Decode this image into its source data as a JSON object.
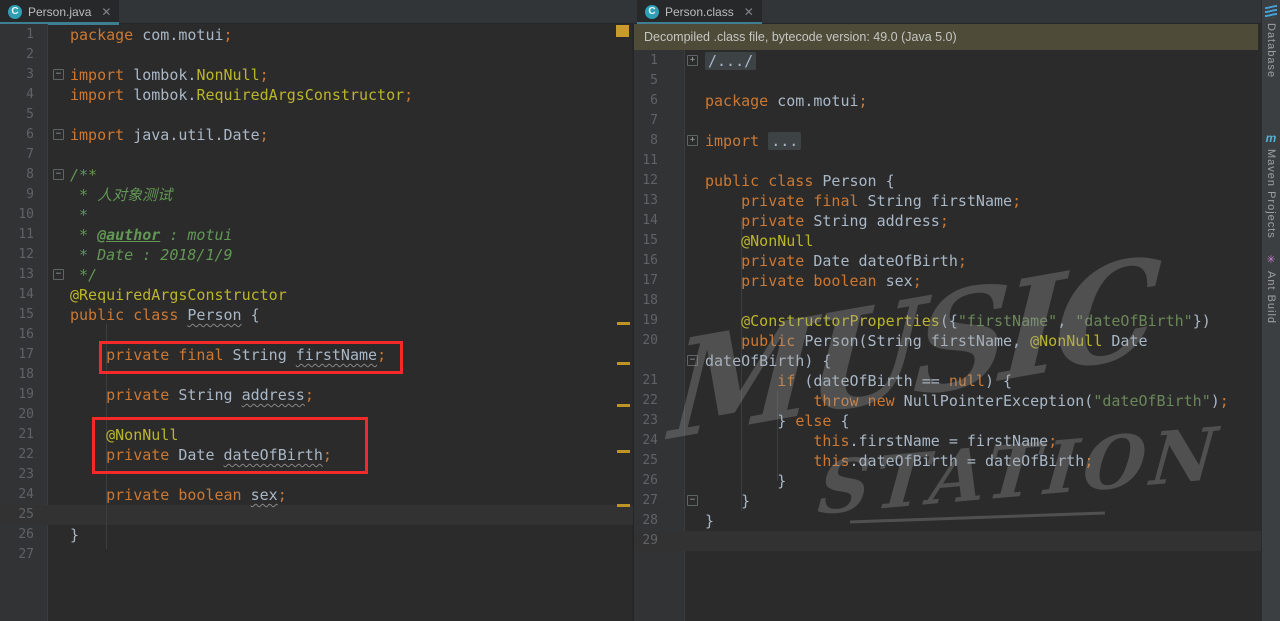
{
  "tabs": {
    "left": {
      "title": "Person.java",
      "icon": "class-icon",
      "close_glyph": "✕"
    },
    "right": {
      "title": "Person.class",
      "icon": "class-icon",
      "close_glyph": "✕"
    }
  },
  "banner": {
    "text": "Decompiled .class file, bytecode version: 49.0 (Java 5.0)"
  },
  "watermark": {
    "line1": "MUSIC",
    "line2": "STATION"
  },
  "tool_stripe": [
    {
      "id": "database",
      "label": "Database",
      "icon": "database-icon"
    },
    {
      "id": "maven",
      "label": "Maven Projects",
      "icon": "maven-icon"
    },
    {
      "id": "ant",
      "label": "Ant Build",
      "icon": "ant-icon"
    }
  ],
  "colors": {
    "tab_accent": "#3e7e93",
    "banner_bg": "#4e4b39",
    "editor_bg": "#2b2b2b",
    "gutter_bg": "#313335",
    "keyword": "#cc7832",
    "annotation": "#bbb529",
    "string": "#6a8759",
    "comment": "#629755",
    "plain_text": "#a9b7c6",
    "line_number": "#606366",
    "red_annotation": "#f42a2a",
    "stripe_mark_gold": "#c89b2d",
    "caret_row": "#323232"
  },
  "annotations": {
    "red_boxes": [
      {
        "target": "private final String firstName;"
      },
      {
        "target": "@NonNull private Date dateOfBirth;"
      }
    ],
    "scrollbar_marks": {
      "square_count": 1,
      "dash_count": 5
    }
  },
  "left_editor": {
    "caret_line": 25,
    "lines": [
      {
        "n": "1",
        "seg": [
          [
            "kw",
            "package"
          ],
          [
            "pl",
            " com.motui"
          ],
          [
            "kw",
            ";"
          ]
        ]
      },
      {
        "n": "2",
        "seg": []
      },
      {
        "n": "3",
        "mark": "open",
        "seg": [
          [
            "kw",
            "import"
          ],
          [
            "pl",
            " lombok."
          ],
          [
            "ann",
            "NonNull"
          ],
          [
            "kw",
            ";"
          ]
        ]
      },
      {
        "n": "4",
        "seg": [
          [
            "kw",
            "import"
          ],
          [
            "pl",
            " lombok."
          ],
          [
            "ann",
            "RequiredArgsConstructor"
          ],
          [
            "kw",
            ";"
          ]
        ]
      },
      {
        "n": "5",
        "seg": []
      },
      {
        "n": "6",
        "mark": "open",
        "seg": [
          [
            "kw",
            "import"
          ],
          [
            "pl",
            " java.util.Date"
          ],
          [
            "kw",
            ";"
          ]
        ]
      },
      {
        "n": "7",
        "seg": []
      },
      {
        "n": "8",
        "mark": "open",
        "seg": [
          [
            "cmt",
            "/**"
          ]
        ]
      },
      {
        "n": "9",
        "seg": [
          [
            "cmt",
            " * 人对象测试"
          ]
        ]
      },
      {
        "n": "10",
        "seg": [
          [
            "cmt",
            " *"
          ]
        ]
      },
      {
        "n": "11",
        "seg": [
          [
            "cmt",
            " * "
          ],
          [
            "cmtu",
            "@author"
          ],
          [
            "cmt",
            " : motui"
          ]
        ]
      },
      {
        "n": "12",
        "seg": [
          [
            "cmt",
            " * Date : 2018/1/9"
          ]
        ]
      },
      {
        "n": "13",
        "mark": "close",
        "seg": [
          [
            "cmt",
            " */"
          ]
        ]
      },
      {
        "n": "14",
        "seg": [
          [
            "ann",
            "@RequiredArgsConstructor"
          ]
        ]
      },
      {
        "n": "15",
        "seg": [
          [
            "kw",
            "public class"
          ],
          [
            "pl",
            " "
          ],
          [
            "wv",
            "Person"
          ],
          [
            "pl",
            " {"
          ]
        ]
      },
      {
        "n": "16",
        "seg": []
      },
      {
        "n": "17",
        "seg": [
          [
            "kw",
            "    private final"
          ],
          [
            "pl",
            " String "
          ],
          [
            "wv",
            "firstName"
          ],
          [
            "kw",
            ";"
          ]
        ]
      },
      {
        "n": "18",
        "seg": []
      },
      {
        "n": "19",
        "seg": [
          [
            "kw",
            "    private"
          ],
          [
            "pl",
            " String "
          ],
          [
            "wv",
            "address"
          ],
          [
            "kw",
            ";"
          ]
        ]
      },
      {
        "n": "20",
        "seg": []
      },
      {
        "n": "21",
        "seg": [
          [
            "ann",
            "    @NonNull"
          ]
        ]
      },
      {
        "n": "22",
        "seg": [
          [
            "kw",
            "    private"
          ],
          [
            "pl",
            " Date "
          ],
          [
            "wv",
            "dateOfBirth"
          ],
          [
            "kw",
            ";"
          ]
        ]
      },
      {
        "n": "23",
        "seg": []
      },
      {
        "n": "24",
        "seg": [
          [
            "kw",
            "    private boolean"
          ],
          [
            "pl",
            " "
          ],
          [
            "wv",
            "sex"
          ],
          [
            "kw",
            ";"
          ]
        ]
      },
      {
        "n": "25",
        "seg": []
      },
      {
        "n": "26",
        "seg": [
          [
            "pl",
            "}"
          ]
        ]
      },
      {
        "n": "27",
        "seg": []
      }
    ]
  },
  "right_editor": {
    "caret_line": 29,
    "lines": [
      {
        "n": "1",
        "mark": "plus",
        "seg": [
          [
            "fold",
            "/.../"
          ]
        ]
      },
      {
        "n": "5",
        "seg": []
      },
      {
        "n": "6",
        "seg": [
          [
            "kw",
            "package"
          ],
          [
            "pl",
            " com.motui"
          ],
          [
            "kw",
            ";"
          ]
        ]
      },
      {
        "n": "7",
        "seg": []
      },
      {
        "n": "8",
        "mark": "plus",
        "seg": [
          [
            "kw",
            "import"
          ],
          [
            "pl",
            " "
          ],
          [
            "fold",
            "..."
          ]
        ]
      },
      {
        "n": "11",
        "seg": []
      },
      {
        "n": "12",
        "seg": [
          [
            "kw",
            "public class"
          ],
          [
            "pl",
            " Person {"
          ]
        ]
      },
      {
        "n": "13",
        "seg": [
          [
            "kw",
            "    private final"
          ],
          [
            "pl",
            " String firstName"
          ],
          [
            "kw",
            ";"
          ]
        ]
      },
      {
        "n": "14",
        "seg": [
          [
            "kw",
            "    private"
          ],
          [
            "pl",
            " String address"
          ],
          [
            "kw",
            ";"
          ]
        ]
      },
      {
        "n": "15",
        "seg": [
          [
            "ann",
            "    @NonNull"
          ]
        ]
      },
      {
        "n": "16",
        "seg": [
          [
            "kw",
            "    private"
          ],
          [
            "pl",
            " Date dateOfBirth"
          ],
          [
            "kw",
            ";"
          ]
        ]
      },
      {
        "n": "17",
        "seg": [
          [
            "kw",
            "    private boolean"
          ],
          [
            "pl",
            " sex"
          ],
          [
            "kw",
            ";"
          ]
        ]
      },
      {
        "n": "18",
        "seg": []
      },
      {
        "n": "19",
        "seg": [
          [
            "ann",
            "    @ConstructorProperties"
          ],
          [
            "pl",
            "({"
          ],
          [
            "str",
            "\"firstName\""
          ],
          [
            "pl",
            ", "
          ],
          [
            "str",
            "\"dateOfBirth\""
          ],
          [
            "pl",
            "})"
          ]
        ]
      },
      {
        "n": "20",
        "seg": [
          [
            "kw",
            "    public"
          ],
          [
            "pl",
            " Person(String firstName, "
          ],
          [
            "ann",
            "@NonNull"
          ],
          [
            "pl",
            " Date"
          ]
        ]
      },
      {
        "n": "",
        "mark": "open",
        "seg": [
          [
            "pl",
            "dateOfBirth) {"
          ]
        ]
      },
      {
        "n": "21",
        "seg": [
          [
            "kw",
            "        if"
          ],
          [
            "pl",
            " (dateOfBirth == "
          ],
          [
            "kw",
            "null"
          ],
          [
            "pl",
            ") {"
          ]
        ]
      },
      {
        "n": "22",
        "seg": [
          [
            "kw",
            "            throw new"
          ],
          [
            "pl",
            " NullPointerException("
          ],
          [
            "str",
            "\"dateOfBirth\""
          ],
          [
            "pl",
            ")"
          ],
          [
            "kw",
            ";"
          ]
        ]
      },
      {
        "n": "23",
        "seg": [
          [
            "pl",
            "        } "
          ],
          [
            "kw",
            "else"
          ],
          [
            "pl",
            " {"
          ]
        ]
      },
      {
        "n": "24",
        "seg": [
          [
            "kw",
            "            this"
          ],
          [
            "pl",
            ".firstName = firstName"
          ],
          [
            "kw",
            ";"
          ]
        ]
      },
      {
        "n": "25",
        "seg": [
          [
            "kw",
            "            this"
          ],
          [
            "pl",
            ".dateOfBirth = dateOfBirth"
          ],
          [
            "kw",
            ";"
          ]
        ]
      },
      {
        "n": "26",
        "seg": [
          [
            "pl",
            "        }"
          ]
        ]
      },
      {
        "n": "27",
        "mark": "close",
        "seg": [
          [
            "pl",
            "    }"
          ]
        ]
      },
      {
        "n": "28",
        "seg": [
          [
            "pl",
            "}"
          ]
        ]
      },
      {
        "n": "29",
        "seg": []
      }
    ]
  }
}
